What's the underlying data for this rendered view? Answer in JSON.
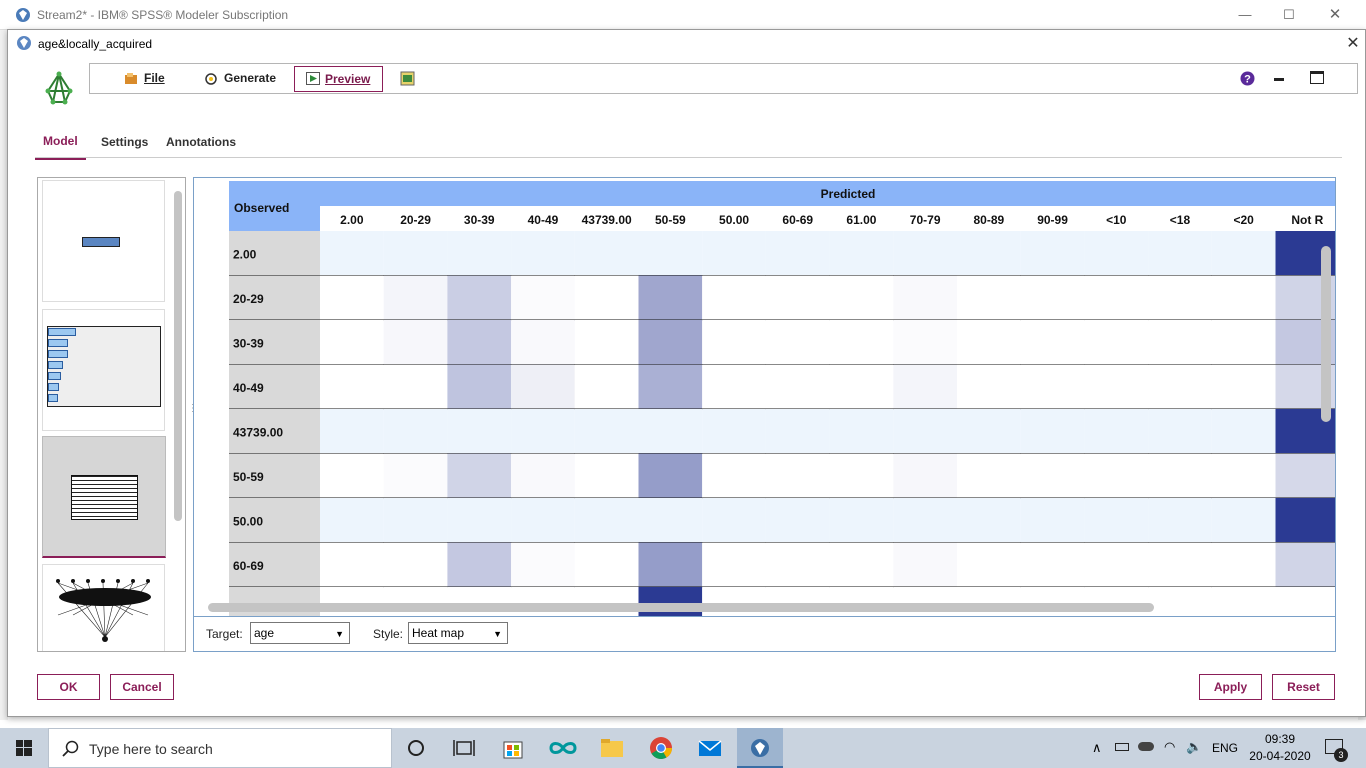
{
  "app": {
    "title": "Stream2* - IBM® SPSS® Modeler Subscription"
  },
  "dialog": {
    "title": "age&locally_acquired"
  },
  "toolbar": {
    "file": "File",
    "generate": "Generate",
    "preview": "Preview"
  },
  "tabs": [
    "Model",
    "Settings",
    "Annotations"
  ],
  "table": {
    "observed_header": "Observed",
    "predicted_header": "Predicted",
    "columns": [
      "2.00",
      "20-29",
      "30-39",
      "40-49",
      "43739.00",
      "50-59",
      "50.00",
      "60-69",
      "61.00",
      "70-79",
      "80-89",
      "90-99",
      "<10",
      "<18",
      "<20",
      "Not R"
    ],
    "rows": [
      {
        "label": "2.00",
        "intensity": [
          0,
          0,
          0,
          0,
          0,
          0,
          0,
          0,
          0,
          0,
          0,
          0,
          0,
          0,
          0,
          1
        ]
      },
      {
        "label": "20-29",
        "intensity": [
          0,
          0.05,
          0.25,
          0.02,
          0,
          0.45,
          0,
          0,
          0,
          0.03,
          0,
          0,
          0,
          0,
          0,
          0.22
        ]
      },
      {
        "label": "30-39",
        "intensity": [
          0,
          0.04,
          0.28,
          0.03,
          0,
          0.45,
          0,
          0,
          0,
          0.02,
          0,
          0,
          0,
          0,
          0,
          0.28
        ]
      },
      {
        "label": "40-49",
        "intensity": [
          0,
          0,
          0.3,
          0.08,
          0,
          0.4,
          0,
          0,
          0,
          0.05,
          0,
          0,
          0,
          0,
          0,
          0.2
        ]
      },
      {
        "label": "43739.00",
        "intensity": [
          0,
          0,
          0,
          0,
          0,
          0,
          0,
          0,
          0,
          0,
          0,
          0,
          0,
          0,
          0,
          1
        ]
      },
      {
        "label": "50-59",
        "intensity": [
          0,
          0.02,
          0.22,
          0.03,
          0,
          0.5,
          0,
          0,
          0,
          0.04,
          0,
          0,
          0,
          0,
          0,
          0.2
        ]
      },
      {
        "label": "50.00",
        "intensity": [
          0,
          0,
          0,
          0,
          0,
          0,
          0,
          0,
          0,
          0,
          0,
          0,
          0,
          0,
          0,
          1
        ]
      },
      {
        "label": "60-69",
        "intensity": [
          0,
          0,
          0.28,
          0.02,
          0,
          0.5,
          0,
          0,
          0,
          0.03,
          0,
          0,
          0,
          0,
          0,
          0.22
        ]
      },
      {
        "label": "",
        "intensity": [
          0,
          0,
          0,
          0,
          0,
          1,
          0,
          0,
          0,
          0,
          0,
          0,
          0,
          0,
          0,
          0
        ]
      }
    ]
  },
  "controls": {
    "target_label": "Target:",
    "target_value": "age",
    "style_label": "Style:",
    "style_value": "Heat map"
  },
  "buttons": {
    "ok": "OK",
    "cancel": "Cancel",
    "apply": "Apply",
    "reset": "Reset"
  },
  "taskbar": {
    "search_placeholder": "Type here to search",
    "lang": "ENG",
    "time": "09:39",
    "date": "20-04-2020",
    "notifications": "3"
  },
  "colors": {
    "accent": "#8b1e58",
    "header_blue": "#8ab4f8",
    "heat_max": "#2b3a93",
    "row_stripe": "#edf5fd"
  }
}
